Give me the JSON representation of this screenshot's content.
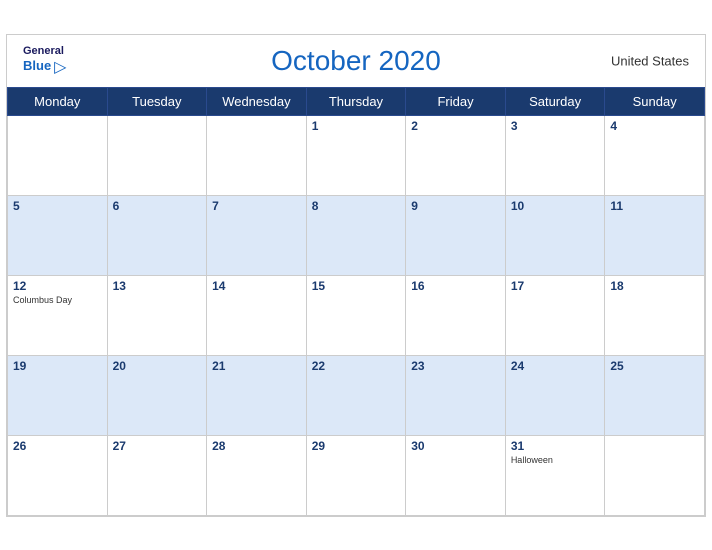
{
  "header": {
    "title": "October 2020",
    "country": "United States",
    "logo": {
      "general": "General",
      "blue": "Blue"
    }
  },
  "weekdays": [
    "Monday",
    "Tuesday",
    "Wednesday",
    "Thursday",
    "Friday",
    "Saturday",
    "Sunday"
  ],
  "weeks": [
    [
      {
        "day": "",
        "event": ""
      },
      {
        "day": "",
        "event": ""
      },
      {
        "day": "",
        "event": ""
      },
      {
        "day": "1",
        "event": ""
      },
      {
        "day": "2",
        "event": ""
      },
      {
        "day": "3",
        "event": ""
      },
      {
        "day": "4",
        "event": ""
      }
    ],
    [
      {
        "day": "5",
        "event": ""
      },
      {
        "day": "6",
        "event": ""
      },
      {
        "day": "7",
        "event": ""
      },
      {
        "day": "8",
        "event": ""
      },
      {
        "day": "9",
        "event": ""
      },
      {
        "day": "10",
        "event": ""
      },
      {
        "day": "11",
        "event": ""
      }
    ],
    [
      {
        "day": "12",
        "event": "Columbus Day"
      },
      {
        "day": "13",
        "event": ""
      },
      {
        "day": "14",
        "event": ""
      },
      {
        "day": "15",
        "event": ""
      },
      {
        "day": "16",
        "event": ""
      },
      {
        "day": "17",
        "event": ""
      },
      {
        "day": "18",
        "event": ""
      }
    ],
    [
      {
        "day": "19",
        "event": ""
      },
      {
        "day": "20",
        "event": ""
      },
      {
        "day": "21",
        "event": ""
      },
      {
        "day": "22",
        "event": ""
      },
      {
        "day": "23",
        "event": ""
      },
      {
        "day": "24",
        "event": ""
      },
      {
        "day": "25",
        "event": ""
      }
    ],
    [
      {
        "day": "26",
        "event": ""
      },
      {
        "day": "27",
        "event": ""
      },
      {
        "day": "28",
        "event": ""
      },
      {
        "day": "29",
        "event": ""
      },
      {
        "day": "30",
        "event": ""
      },
      {
        "day": "31",
        "event": "Halloween"
      },
      {
        "day": "",
        "event": ""
      }
    ]
  ]
}
